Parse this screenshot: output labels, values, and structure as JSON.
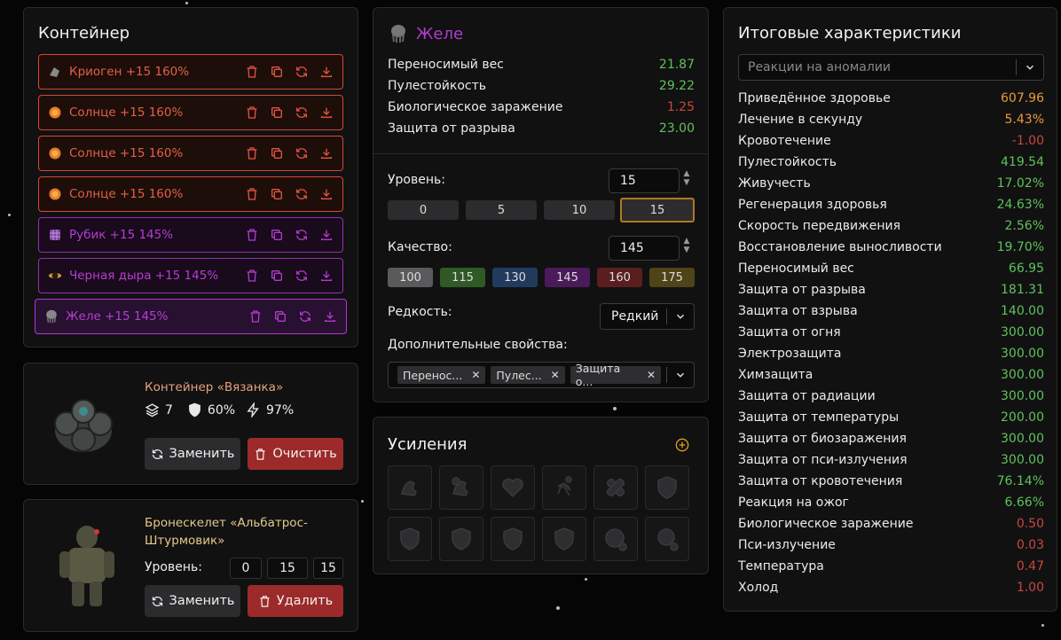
{
  "container": {
    "title": "Контейнер",
    "slots": [
      {
        "label": "Криоген +15 160%",
        "icon": "cryogen-artifact-icon",
        "style": "red"
      },
      {
        "label": "Солнце +15 160%",
        "icon": "sun-artifact-icon",
        "style": "red"
      },
      {
        "label": "Солнце +15 160%",
        "icon": "sun-artifact-icon",
        "style": "red"
      },
      {
        "label": "Солнце +15 160%",
        "icon": "sun-artifact-icon",
        "style": "red"
      },
      {
        "label": "Рубик +15 145%",
        "icon": "rubik-artifact-icon",
        "style": "purple"
      },
      {
        "label": "Черная дыра +15 145%",
        "icon": "black-hole-artifact-icon",
        "style": "purple"
      },
      {
        "label": "Желе +15 145%",
        "icon": "jelly-artifact-icon",
        "style": "purple-selected"
      }
    ],
    "slot_actions": [
      "delete-icon",
      "copy-icon",
      "refresh-icon",
      "download-icon"
    ]
  },
  "container_card": {
    "name": "Контейнер «Вязанка»",
    "slots_count": "7",
    "protection": "60%",
    "efficiency": "97%",
    "replace_label": "Заменить",
    "clear_label": "Очистить"
  },
  "armor_card": {
    "name": "Бронескелет «Альбатрос-Штурмовик»",
    "level_label": "Уровень:",
    "level_values": [
      "0",
      "15",
      "15"
    ],
    "replace_label": "Заменить",
    "delete_label": "Удалить"
  },
  "item": {
    "name": "Желе",
    "stats": [
      {
        "label": "Переносимый вес",
        "value": "21.87",
        "tone": "green"
      },
      {
        "label": "Пулестойкость",
        "value": "29.22",
        "tone": "green"
      },
      {
        "label": "Биологическое заражение",
        "value": "1.25",
        "tone": "red"
      },
      {
        "label": "Защита от разрыва",
        "value": "23.00",
        "tone": "green"
      }
    ],
    "level_label": "Уровень:",
    "level_value": "15",
    "level_presets": [
      "0",
      "5",
      "10",
      "15"
    ],
    "quality_label": "Качество:",
    "quality_value": "145",
    "quality_presets": [
      {
        "label": "100",
        "color": "#5a5a5c"
      },
      {
        "label": "115",
        "color": "#2f5a26"
      },
      {
        "label": "130",
        "color": "#223a5e"
      },
      {
        "label": "145",
        "color": "#4b1a5a"
      },
      {
        "label": "160",
        "color": "#5a1e1e"
      },
      {
        "label": "175",
        "color": "#4e4418"
      }
    ],
    "rarity_label": "Редкость:",
    "rarity_value": "Редкий",
    "extra_label": "Дополнительные свойства:",
    "extra_tags": [
      "Перенос...",
      "Пулес...",
      "Защита о..."
    ]
  },
  "boosts": {
    "title": "Усиления",
    "icons": [
      "strength-icon",
      "arm-timer-icon",
      "heart-plus-icon",
      "running-icon",
      "bandage-icon",
      "shield-icon",
      "thermometer-shield-icon",
      "radiation-shield-icon",
      "biohazard-shield-icon",
      "psi-shield-icon",
      "radiation-minus-icon",
      "head-gear-minus-icon"
    ]
  },
  "results": {
    "title": "Итоговые характеристики",
    "filter_placeholder": "Реакции на аномалии",
    "rows": [
      {
        "label": "Приведённое здоровье",
        "value": "607.96",
        "tone": "orange"
      },
      {
        "label": "Лечение в секунду",
        "value": "5.43%",
        "tone": "orange"
      },
      {
        "label": "Кровотечение",
        "value": "-1.00",
        "tone": "red"
      },
      {
        "label": "Пулестойкость",
        "value": "419.54",
        "tone": "green"
      },
      {
        "label": "Живучесть",
        "value": "17.02%",
        "tone": "green"
      },
      {
        "label": "Регенерация здоровья",
        "value": "24.63%",
        "tone": "green"
      },
      {
        "label": "Скорость передвижения",
        "value": "2.56%",
        "tone": "green"
      },
      {
        "label": "Восстановление выносливости",
        "value": "19.70%",
        "tone": "green"
      },
      {
        "label": "Переносимый вес",
        "value": "66.95",
        "tone": "green"
      },
      {
        "label": "Защита от разрыва",
        "value": "181.31",
        "tone": "green"
      },
      {
        "label": "Защита от взрыва",
        "value": "140.00",
        "tone": "green"
      },
      {
        "label": "Защита от огня",
        "value": "300.00",
        "tone": "green"
      },
      {
        "label": "Электрозащита",
        "value": "300.00",
        "tone": "green"
      },
      {
        "label": "Химзащита",
        "value": "300.00",
        "tone": "green"
      },
      {
        "label": "Защита от радиации",
        "value": "300.00",
        "tone": "green"
      },
      {
        "label": "Защита от температуры",
        "value": "200.00",
        "tone": "green"
      },
      {
        "label": "Защита от биозаражения",
        "value": "300.00",
        "tone": "green"
      },
      {
        "label": "Защита от пси-излучения",
        "value": "300.00",
        "tone": "green"
      },
      {
        "label": "Защита от кровотечения",
        "value": "76.14%",
        "tone": "green"
      },
      {
        "label": "Реакция на ожог",
        "value": "6.66%",
        "tone": "green"
      },
      {
        "label": "Биологическое заражение",
        "value": "0.50",
        "tone": "red"
      },
      {
        "label": "Пси-излучение",
        "value": "0.03",
        "tone": "red"
      },
      {
        "label": "Температура",
        "value": "0.47",
        "tone": "red"
      },
      {
        "label": "Холод",
        "value": "1.00",
        "tone": "red"
      }
    ]
  }
}
